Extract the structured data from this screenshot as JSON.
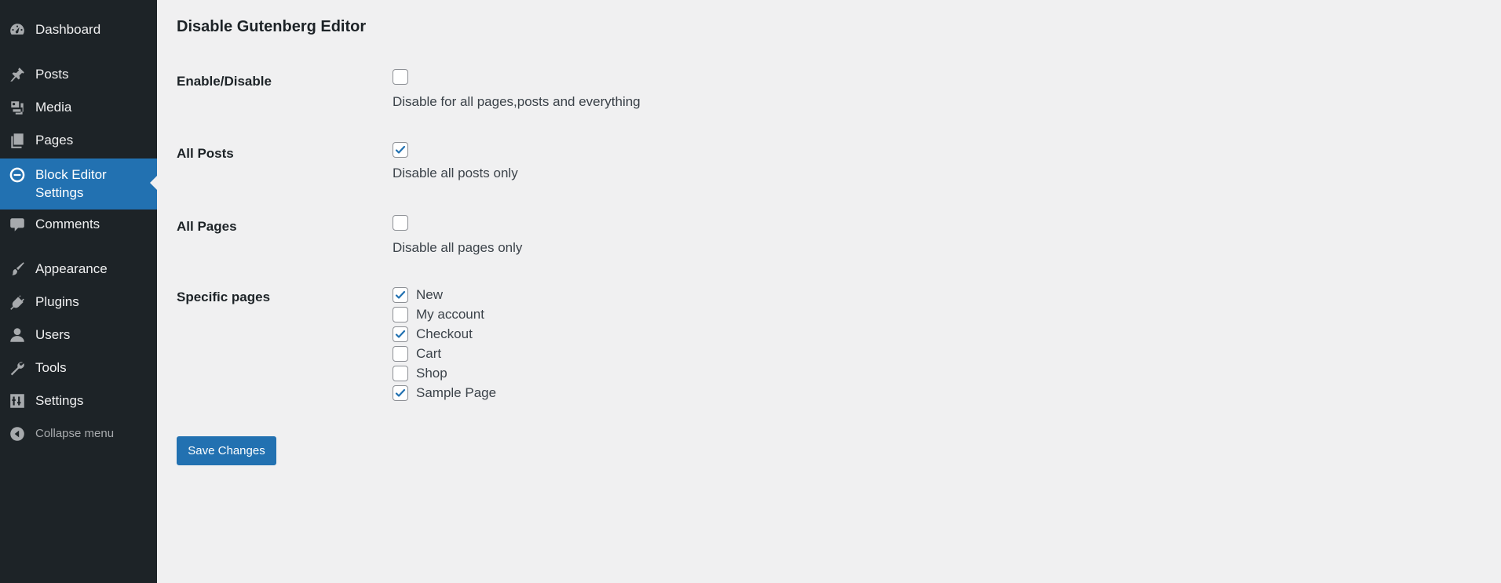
{
  "sidebar": {
    "items": [
      {
        "label": "Dashboard",
        "icon": "dashboard-icon"
      },
      {
        "label": "Posts",
        "icon": "pin-icon"
      },
      {
        "label": "Media",
        "icon": "media-icon"
      },
      {
        "label": "Pages",
        "icon": "pages-icon"
      },
      {
        "label": "Block Editor\nSettings",
        "icon": "minus-circle-icon",
        "active": true
      },
      {
        "label": "Comments",
        "icon": "comment-icon"
      },
      {
        "label": "Appearance",
        "icon": "brush-icon"
      },
      {
        "label": "Plugins",
        "icon": "plugin-icon"
      },
      {
        "label": "Users",
        "icon": "user-icon"
      },
      {
        "label": "Tools",
        "icon": "wrench-icon"
      },
      {
        "label": "Settings",
        "icon": "settings-icon"
      }
    ],
    "collapse_label": "Collapse menu"
  },
  "main": {
    "title": "Disable Gutenberg Editor",
    "settings": [
      {
        "label": "Enable/Disable",
        "checked": false,
        "description": "Disable for all pages,posts and everything"
      },
      {
        "label": "All Posts",
        "checked": true,
        "description": "Disable all posts only"
      },
      {
        "label": "All Pages",
        "checked": false,
        "description": "Disable all pages only"
      }
    ],
    "specific_pages": {
      "label": "Specific pages",
      "pages": [
        {
          "name": "New",
          "checked": true
        },
        {
          "name": "My account",
          "checked": false
        },
        {
          "name": "Checkout",
          "checked": true
        },
        {
          "name": "Cart",
          "checked": false
        },
        {
          "name": "Shop",
          "checked": false
        },
        {
          "name": "Sample Page",
          "checked": true
        }
      ]
    },
    "save_label": "Save Changes"
  },
  "colors": {
    "sidebar_bg": "#1d2327",
    "accent": "#2271b1",
    "page_bg": "#f0f0f1"
  }
}
